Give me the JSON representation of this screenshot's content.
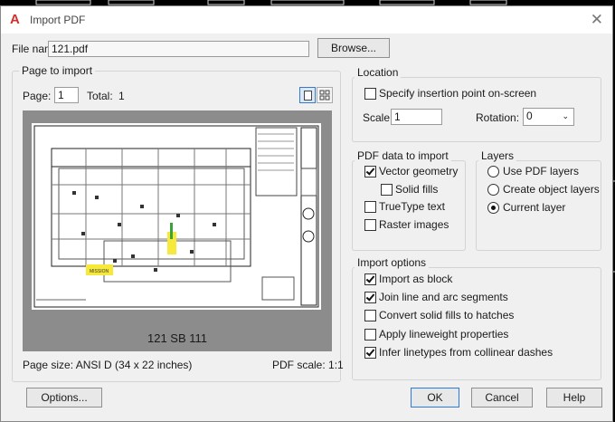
{
  "window": {
    "title": "Import PDF",
    "close": "✕"
  },
  "file": {
    "label": "File name:",
    "value": "121.pdf",
    "browse": "Browse..."
  },
  "page_to_import": {
    "group": "Page to import",
    "page_label": "Page:",
    "page_value": "1",
    "total_label": "Total:",
    "total_value": "1",
    "caption": "121 SB 111",
    "page_size": "Page size:  ANSI D (34 x 22 inches)",
    "pdf_scale": "PDF scale:  1:1",
    "highlight_text": "MISSION"
  },
  "location": {
    "group": "Location",
    "specify": "Specify insertion point on-screen",
    "scale_label": "Scale:",
    "scale_value": "1",
    "rotation_label": "Rotation:",
    "rotation_value": "0"
  },
  "pdf_data": {
    "group": "PDF data to import",
    "vector": "Vector geometry",
    "solid": "Solid fills",
    "truetype": "TrueType text",
    "raster": "Raster images"
  },
  "layers": {
    "group": "Layers",
    "use_pdf": "Use PDF layers",
    "create_object": "Create object layers",
    "current": "Current layer"
  },
  "import_options": {
    "group": "Import options",
    "as_block": "Import as block",
    "join": "Join line and arc segments",
    "convert": "Convert solid fills to hatches",
    "lineweight": "Apply lineweight properties",
    "infer": "Infer linetypes from collinear dashes"
  },
  "buttons": {
    "options": "Options...",
    "ok": "OK",
    "cancel": "Cancel",
    "help": "Help"
  },
  "colors": {
    "accent_red": "#d32f2f",
    "highlight_yellow": "#f6e93a",
    "default_border": "#3a78c8"
  },
  "icons": {
    "app": "autocad-a-icon",
    "single_page": "single-page-view-icon",
    "grid": "thumbnail-grid-icon",
    "dropdown": "chevron-down-icon"
  }
}
